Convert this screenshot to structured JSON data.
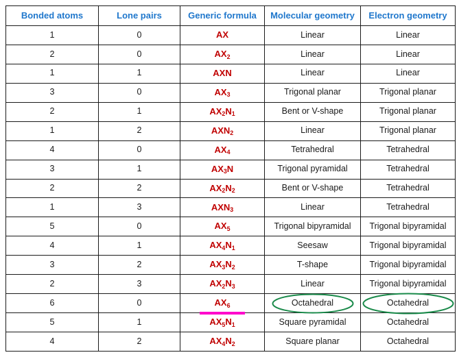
{
  "table": {
    "headers": [
      "Bonded atoms",
      "Lone pairs",
      "Generic formula",
      "Molecular geometry",
      "Electron geometry"
    ],
    "rows": [
      {
        "bonded": "1",
        "lone": "0",
        "formula_base": "AX",
        "formula_sub": "",
        "formula_tail": "",
        "formula_tail_sub": "",
        "molecular": "Linear",
        "electron": "Linear"
      },
      {
        "bonded": "2",
        "lone": "0",
        "formula_base": "AX",
        "formula_sub": "2",
        "formula_tail": "",
        "formula_tail_sub": "",
        "molecular": "Linear",
        "electron": "Linear"
      },
      {
        "bonded": "1",
        "lone": "1",
        "formula_base": "AX",
        "formula_sub": "",
        "formula_tail": "N",
        "formula_tail_sub": "",
        "molecular": "Linear",
        "electron": "Linear"
      },
      {
        "bonded": "3",
        "lone": "0",
        "formula_base": "AX",
        "formula_sub": "3",
        "formula_tail": "",
        "formula_tail_sub": "",
        "molecular": "Trigonal planar",
        "electron": "Trigonal planar"
      },
      {
        "bonded": "2",
        "lone": "1",
        "formula_base": "AX",
        "formula_sub": "2",
        "formula_tail": "N",
        "formula_tail_sub": "1",
        "molecular": "Bent or V-shape",
        "electron": "Trigonal planar"
      },
      {
        "bonded": "1",
        "lone": "2",
        "formula_base": "AX",
        "formula_sub": "",
        "formula_tail": "N",
        "formula_tail_sub": "2",
        "molecular": "Linear",
        "electron": "Trigonal planar"
      },
      {
        "bonded": "4",
        "lone": "0",
        "formula_base": "AX",
        "formula_sub": "4",
        "formula_tail": "",
        "formula_tail_sub": "",
        "molecular": "Tetrahedral",
        "electron": "Tetrahedral"
      },
      {
        "bonded": "3",
        "lone": "1",
        "formula_base": "AX",
        "formula_sub": "3",
        "formula_tail": "N",
        "formula_tail_sub": "",
        "molecular": "Trigonal pyramidal",
        "electron": "Tetrahedral"
      },
      {
        "bonded": "2",
        "lone": "2",
        "formula_base": "AX",
        "formula_sub": "2",
        "formula_tail": "N",
        "formula_tail_sub": "2",
        "molecular": "Bent or V-shape",
        "electron": "Tetrahedral"
      },
      {
        "bonded": "1",
        "lone": "3",
        "formula_base": "AX",
        "formula_sub": "",
        "formula_tail": "N",
        "formula_tail_sub": "3",
        "molecular": "Linear",
        "electron": "Tetrahedral"
      },
      {
        "bonded": "5",
        "lone": "0",
        "formula_base": "AX",
        "formula_sub": "5",
        "formula_tail": "",
        "formula_tail_sub": "",
        "molecular": "Trigonal bipyramidal",
        "electron": "Trigonal bipyramidal"
      },
      {
        "bonded": "4",
        "lone": "1",
        "formula_base": "AX",
        "formula_sub": "4",
        "formula_tail": "N",
        "formula_tail_sub": "1",
        "molecular": "Seesaw",
        "electron": "Trigonal bipyramidal"
      },
      {
        "bonded": "3",
        "lone": "2",
        "formula_base": "AX",
        "formula_sub": "3",
        "formula_tail": "N",
        "formula_tail_sub": "2",
        "molecular": "T-shape",
        "electron": "Trigonal bipyramidal"
      },
      {
        "bonded": "2",
        "lone": "3",
        "formula_base": "AX",
        "formula_sub": "2",
        "formula_tail": "N",
        "formula_tail_sub": "3",
        "molecular": "Linear",
        "electron": "Trigonal bipyramidal"
      },
      {
        "bonded": "6",
        "lone": "0",
        "formula_base": "AX",
        "formula_sub": "6",
        "formula_tail": "",
        "formula_tail_sub": "",
        "molecular": "Octahedral",
        "electron": "Octahedral"
      },
      {
        "bonded": "5",
        "lone": "1",
        "formula_base": "AX",
        "formula_sub": "5",
        "formula_tail": "N",
        "formula_tail_sub": "1",
        "molecular": "Square pyramidal",
        "electron": "Octahedral"
      },
      {
        "bonded": "4",
        "lone": "2",
        "formula_base": "AX",
        "formula_sub": "4",
        "formula_tail": "N",
        "formula_tail_sub": "2",
        "molecular": "Square planar",
        "electron": "Octahedral"
      }
    ]
  },
  "annotations": {
    "highlighted_row_index": 14,
    "underline_color": "#ff00cc",
    "ellipse_color": "#1a8a4a",
    "header_color": "#1f77cc",
    "formula_color": "#c00000",
    "border_color": "#1a1a1a",
    "ellipse_targets": [
      "Octahedral",
      "Octahedral"
    ]
  }
}
